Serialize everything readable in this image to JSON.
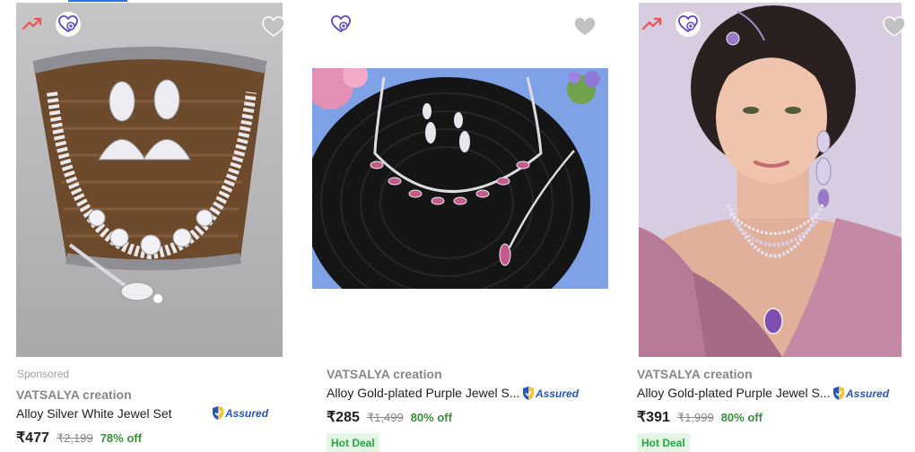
{
  "products": [
    {
      "sponsored": "Sponsored",
      "brand": "VATSALYA creation",
      "title": "Alloy Silver White Jewel Set",
      "assured": "Assured",
      "price": "₹477",
      "mrp": "₹2,199",
      "discount": "78% off",
      "image": {
        "desc": "silver jhumka necklace set in wicker basket",
        "bg": "#b9b9bb"
      }
    },
    {
      "brand": "VATSALYA creation",
      "title": "Alloy Gold-plated Purple Jewel S...",
      "assured": "Assured",
      "price": "₹285",
      "mrp": "₹1,499",
      "discount": "80% off",
      "deal": "Hot Deal",
      "image": {
        "desc": "purple stone necklace set on black knit cushion",
        "bg": "#7fa2e6"
      }
    },
    {
      "brand": "VATSALYA creation",
      "title": "Alloy Gold-plated Purple Jewel S...",
      "assured": "Assured",
      "price": "₹391",
      "mrp": "₹1,999",
      "discount": "80% off",
      "deal": "Hot Deal",
      "image": {
        "desc": "model wearing purple layered necklace and maang tikka",
        "bg": "#d7cce0"
      }
    }
  ],
  "icons": {
    "trending": "trending-up-icon",
    "wishlist": "heart-plus-icon",
    "favorite": "heart-icon",
    "assured": "shield-check-icon"
  },
  "colors": {
    "trending": "#ef5350",
    "wishlist": "#5a44c9",
    "heart": "#c2c2c2",
    "discount": "#388e3c",
    "deal_bg": "#e4f7e5",
    "assured": "#2455b8"
  }
}
